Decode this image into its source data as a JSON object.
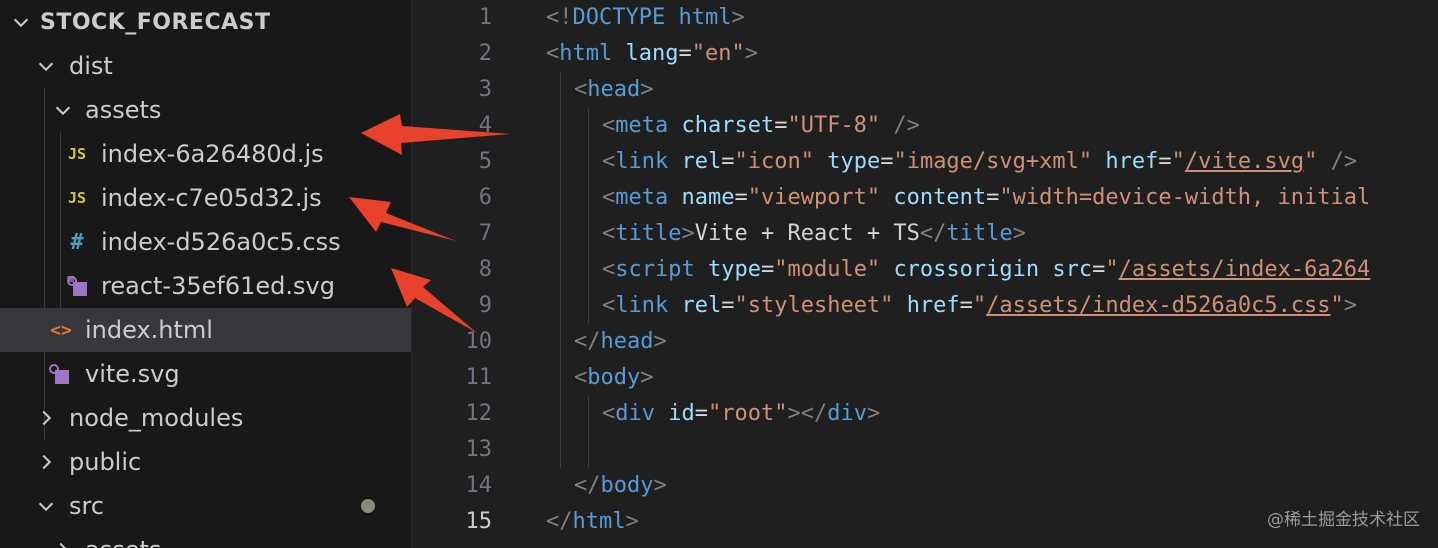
{
  "explorer": {
    "root": "STOCK_FORECAST",
    "items": [
      {
        "label": "dist"
      },
      {
        "label": "assets"
      },
      {
        "label": "index-6a26480d.js",
        "icon": "JS"
      },
      {
        "label": "index-c7e05d32.js",
        "icon": "JS"
      },
      {
        "label": "index-d526a0c5.css",
        "icon": "#"
      },
      {
        "label": "react-35ef61ed.svg"
      },
      {
        "label": "index.html",
        "icon": "<>"
      },
      {
        "label": "vite.svg"
      },
      {
        "label": "node_modules"
      },
      {
        "label": "public"
      },
      {
        "label": "src"
      },
      {
        "label": "assets"
      }
    ]
  },
  "editor": {
    "line_numbers": [
      "1",
      "2",
      "3",
      "4",
      "5",
      "6",
      "7",
      "8",
      "9",
      "10",
      "11",
      "12",
      "13",
      "14",
      "15"
    ],
    "active_line": "15",
    "lines": [
      {
        "t": [
          "<!",
          "DOCTYPE html",
          ">"
        ]
      },
      {
        "t": [
          "<",
          "html",
          " ",
          "lang",
          "=",
          "\"en\"",
          ">"
        ]
      },
      {
        "t": [
          "<",
          "head",
          ">"
        ]
      },
      {
        "t": [
          "<",
          "meta",
          " ",
          "charset",
          "=",
          "\"UTF-8\"",
          " />"
        ]
      },
      {
        "t": [
          "<",
          "link",
          " ",
          "rel",
          "=",
          "\"icon\"",
          " ",
          "type",
          "=",
          "\"image/svg+xml\"",
          " ",
          "href",
          "=",
          "\"",
          "/vite.svg",
          "\"",
          " />"
        ]
      },
      {
        "t": [
          "<",
          "meta",
          " ",
          "name",
          "=",
          "\"viewport\"",
          " ",
          "content",
          "=",
          "\"width=device-width, initial"
        ]
      },
      {
        "t": [
          "<",
          "title",
          ">",
          "Vite + React + TS",
          "</",
          "title",
          ">"
        ]
      },
      {
        "t": [
          "<",
          "script",
          " ",
          "type",
          "=",
          "\"module\"",
          " ",
          "crossorigin",
          " ",
          "src",
          "=",
          "\"",
          "/assets/index-6a264"
        ]
      },
      {
        "t": [
          "<",
          "link",
          " ",
          "rel",
          "=",
          "\"stylesheet\"",
          " ",
          "href",
          "=",
          "\"",
          "/assets/index-d526a0c5.css",
          "\"",
          ">"
        ]
      },
      {
        "t": [
          "</",
          "head",
          ">"
        ]
      },
      {
        "t": [
          "<",
          "body",
          ">"
        ]
      },
      {
        "t": [
          "<",
          "div",
          " ",
          "id",
          "=",
          "\"root\"",
          "></",
          "div",
          ">"
        ]
      },
      {
        "t": []
      },
      {
        "t": [
          "</",
          "body",
          ">"
        ]
      },
      {
        "t": [
          "</",
          "html",
          ">"
        ]
      }
    ]
  },
  "colors": {
    "accent_arrow": "#e8412c",
    "tag": "#569cd6",
    "attr": "#9cdcfe",
    "string": "#ce9178"
  },
  "watermark": "@稀土掘金技术社区"
}
